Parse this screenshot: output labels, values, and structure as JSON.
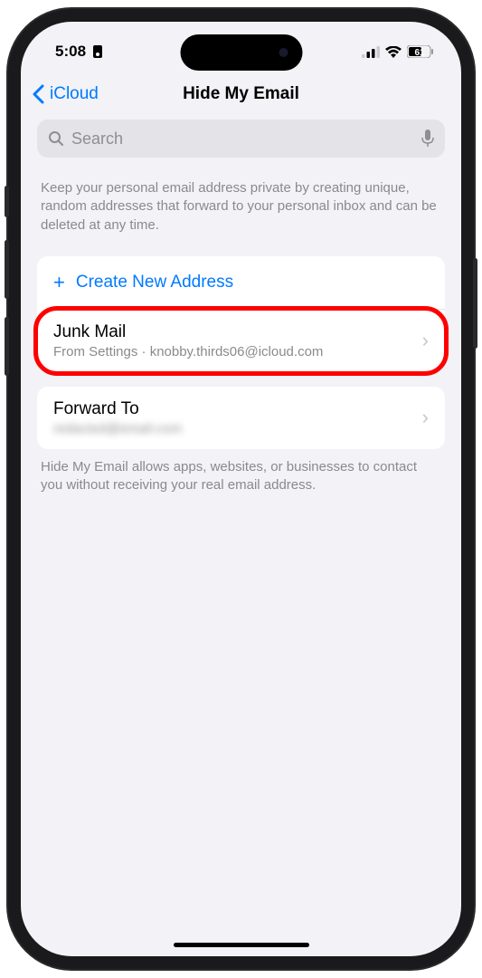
{
  "statusBar": {
    "time": "5:08",
    "battery": "61"
  },
  "nav": {
    "back": "iCloud",
    "title": "Hide My Email"
  },
  "search": {
    "placeholder": "Search"
  },
  "desc": {
    "top": "Keep your personal email address private by creating unique, random addresses that forward to your personal inbox and can be deleted at any time.",
    "bottom": "Hide My Email allows apps, websites, or businesses to contact you without receiving your real email address."
  },
  "actions": {
    "create": "Create New Address"
  },
  "entries": [
    {
      "title": "Junk Mail",
      "sub": "From Settings · knobby.thirds06@icloud.com"
    }
  ],
  "forward": {
    "title": "Forward To",
    "sub": "redacted@email.com"
  }
}
